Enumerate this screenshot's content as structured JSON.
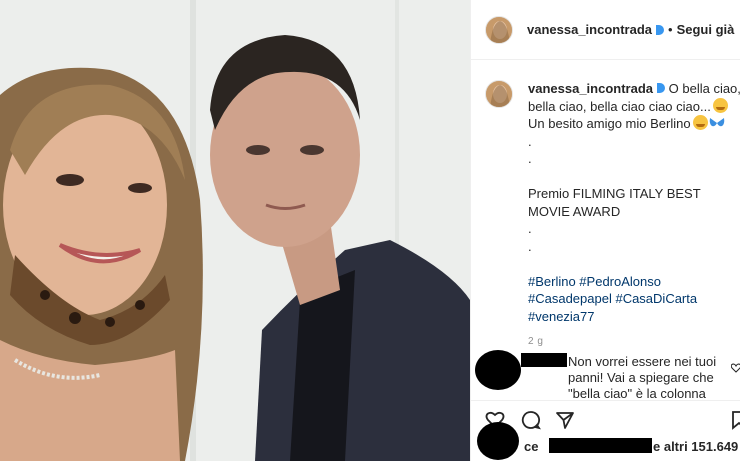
{
  "header": {
    "username": "vanessa_incontrada",
    "separator": "•",
    "follow_label": "Segui già"
  },
  "caption": {
    "username": "vanessa_incontrada",
    "lines": [
      "O bella ciao,",
      "bella ciao, bella ciao ciao ciao...",
      "Un besito amigo mio Berlino",
      ".",
      ".",
      "Premio FILMING ITALY BEST MOVIE AWARD",
      ".",
      "."
    ],
    "hashtag_lines": [
      "#Berlino #PedroAlonso",
      "#Casadepapel #CasaDiCarta",
      "#venezia77"
    ],
    "time": "2 g"
  },
  "comment": {
    "text": "Non vorrei essere nei tuoi panni! Vai a spiegare che \"bella ciao\" è la colonna sonora della"
  },
  "likes": {
    "prefix": "ce",
    "suffix": "e altri 151.649"
  },
  "colors": {
    "text": "#262626",
    "hashtag": "#00376b",
    "verified": "#3897f0",
    "muted": "#8e8e8e"
  },
  "icons": [
    "verified-badge-icon",
    "smiling-face-icon",
    "butterfly-icon",
    "heart-icon",
    "comment-icon",
    "share-icon",
    "bookmark-icon"
  ]
}
